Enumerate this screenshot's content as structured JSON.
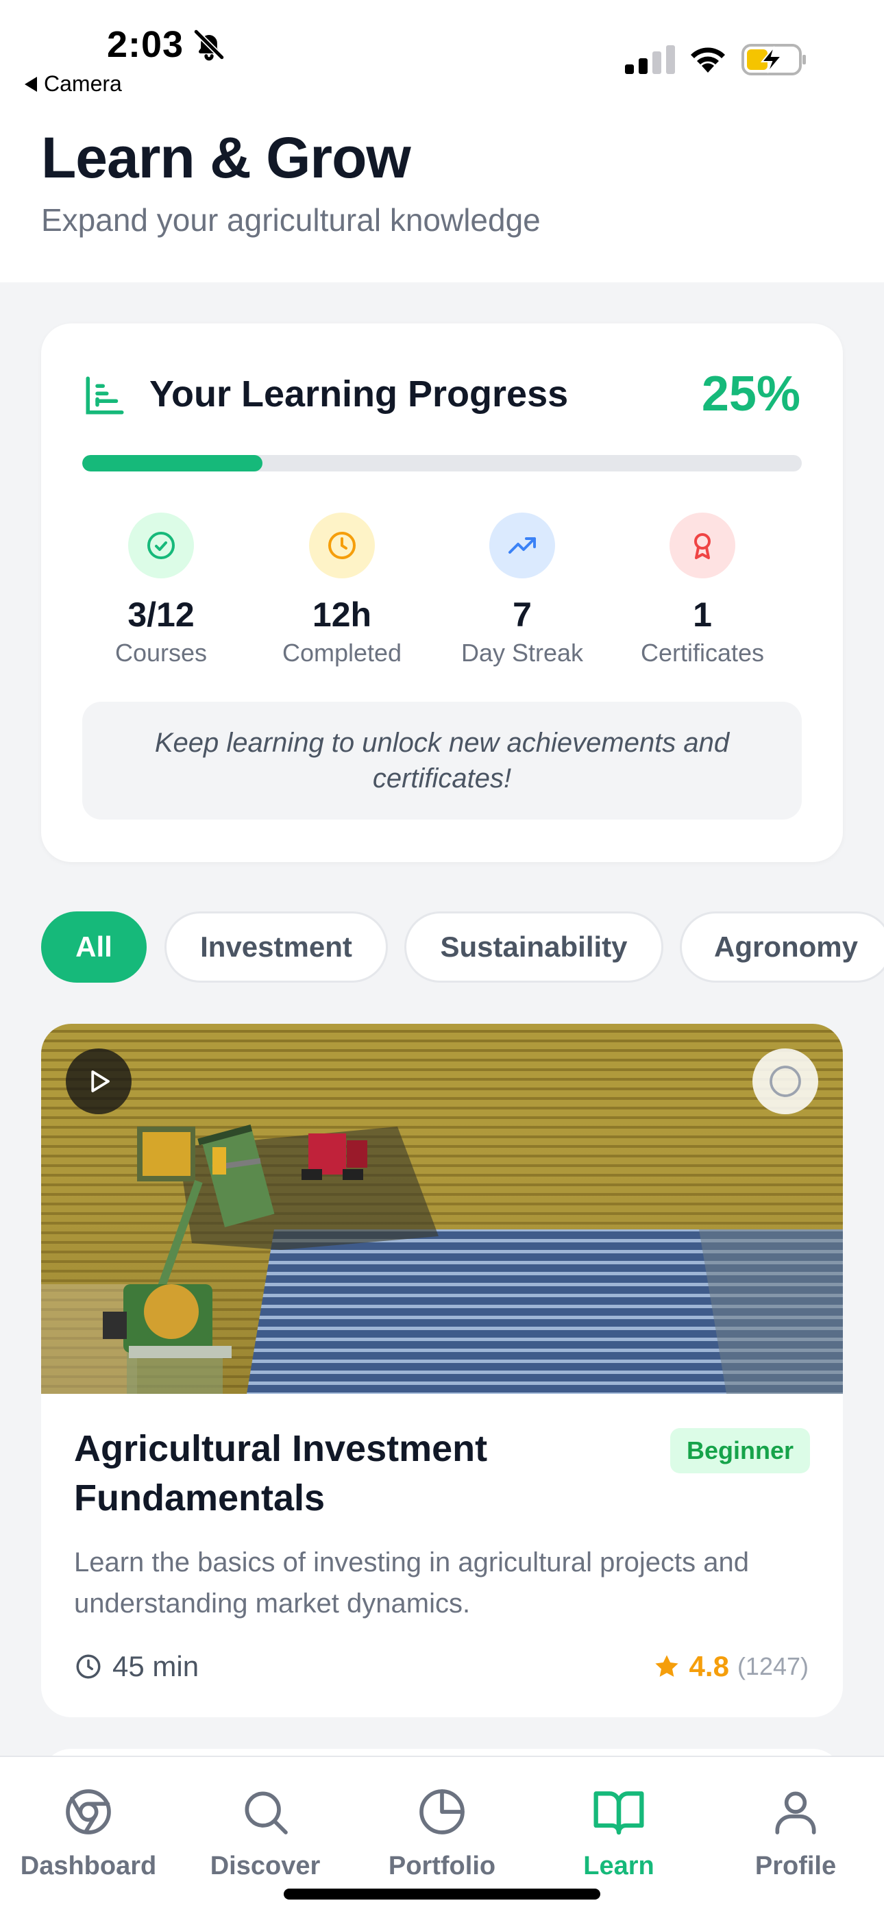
{
  "status_bar": {
    "time": "2:03",
    "back_app": "Camera"
  },
  "header": {
    "title": "Learn & Grow",
    "subtitle": "Expand your agricultural knowledge"
  },
  "progress": {
    "title": "Your Learning Progress",
    "percent_label": "25%",
    "percent_value": 0.25,
    "stats": [
      {
        "value": "3/12",
        "label": "Courses",
        "icon": "check-circle-icon",
        "bg": "#dcfce7",
        "color": "#16b97a"
      },
      {
        "value": "12h",
        "label": "Completed",
        "icon": "clock-icon",
        "bg": "#fef3c7",
        "color": "#f59e0b"
      },
      {
        "value": "7",
        "label": "Day Streak",
        "icon": "trending-up-icon",
        "bg": "#dbeafe",
        "color": "#3b82f6"
      },
      {
        "value": "1",
        "label": "Certificates",
        "icon": "award-icon",
        "bg": "#fee2e2",
        "color": "#ef4444"
      }
    ],
    "tip": "Keep learning to unlock new achievements and certificates!"
  },
  "filters": {
    "chips": [
      "All",
      "Investment",
      "Sustainability",
      "Agronomy"
    ],
    "active_index": 0
  },
  "course": {
    "title": "Agricultural Investment Fundamentals",
    "level": "Beginner",
    "description": "Learn the basics of investing in agricultural projects and understanding market dynamics.",
    "duration": "45 min",
    "rating": "4.8",
    "rating_count": "(1247)"
  },
  "tabbar": {
    "tabs": [
      "Dashboard",
      "Discover",
      "Portfolio",
      "Learn",
      "Profile"
    ],
    "active_index": 3
  },
  "colors": {
    "accent": "#16b97a",
    "star": "#f59e0b"
  }
}
